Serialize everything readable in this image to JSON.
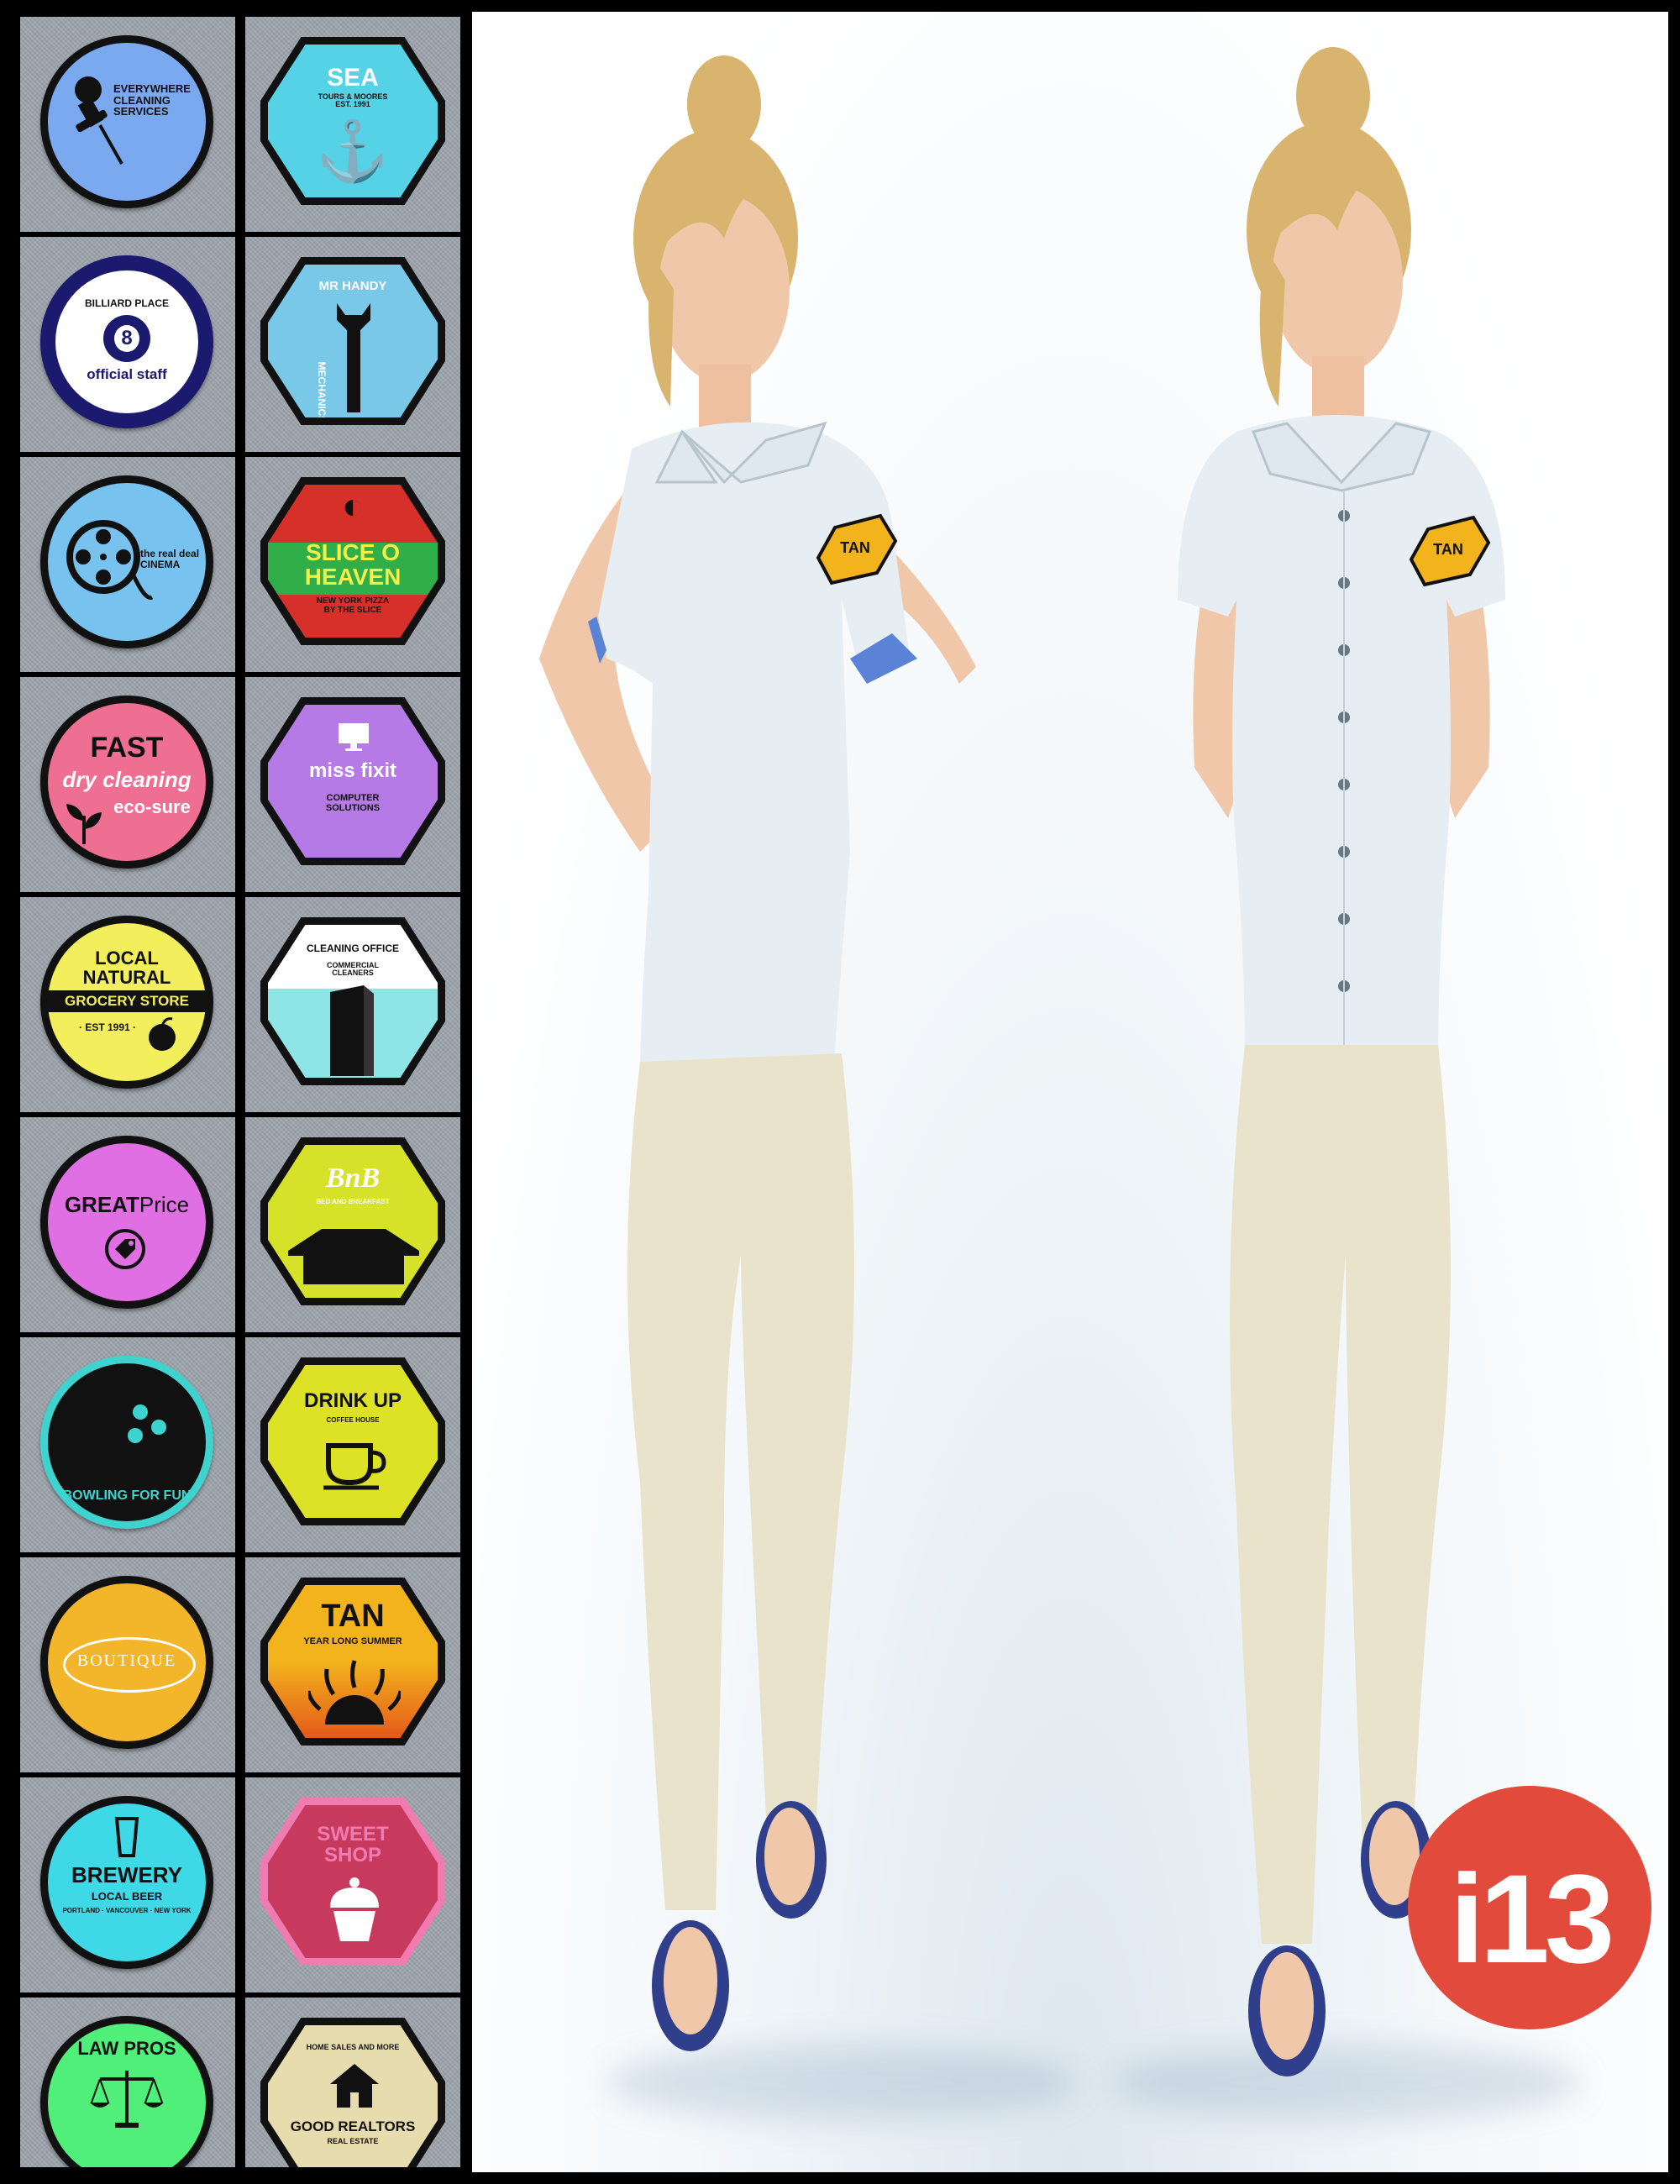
{
  "colors": {
    "fabric": "#9fa6af",
    "shirt": "#e6eef4",
    "pants": "#e9e3cc",
    "skin": "#f1c7a9",
    "hair": "#d9b46e",
    "logo_bg": "#e24a3b"
  },
  "badges": {
    "cleaning": {
      "text": "EVERYWHERE\nCLEANING\nSERVICES",
      "icon": "pushpin-icon",
      "color": "#7aa9f0"
    },
    "sea": {
      "title": "SEA",
      "sub": "TOURS & MOORES\nEST. 1991",
      "icon": "anchor-icon",
      "color": "#56d2e6"
    },
    "billiard": {
      "title": "BILLIARD PLACE",
      "number": "8",
      "sub": "official staff",
      "icon": "eight-ball-icon",
      "color": "#ffffff"
    },
    "mrhandy": {
      "title": "MR HANDY",
      "sub": "MECHANICS",
      "icon": "wrench-icon",
      "color": "#7ac8e8"
    },
    "cinema": {
      "text": "the real deal\nCINEMA",
      "icon": "film-reel-icon",
      "color": "#78c2ef"
    },
    "pizza": {
      "title": "SLICE O\nHEAVEN",
      "sub": "NEW YORK PIZZA\nBY THE SLICE",
      "icon": "pizza-icon",
      "color": "#d7302b",
      "accent": "#2fae4a"
    },
    "dryclean": {
      "title": "FAST",
      "script": "dry cleaning",
      "sub": "eco-sure",
      "icon": "leaf-icon",
      "color": "#ef6f93"
    },
    "missfixit": {
      "title": "miss fixit",
      "sub": "COMPUTER\nSOLUTIONS",
      "icon": "monitor-icon",
      "color": "#b57ae6"
    },
    "grocery": {
      "title": "LOCAL\nNATURAL",
      "band": "GROCERY STORE",
      "sub": "· EST 1991 ·",
      "icon": "apple-icon",
      "color": "#f2ee5c"
    },
    "cleaningoffice": {
      "title": "CLEANING OFFICE",
      "sub": "COMMERCIAL\nCLEANERS",
      "icon": "building-icon",
      "color": "#8fe4e6"
    },
    "greatprice": {
      "bold": "GREAT",
      "light": "Price",
      "icon": "price-tag-icon",
      "color": "#df6fe3"
    },
    "bnb": {
      "title": "BnB",
      "sub": "BED AND BREAKFAST",
      "icon": "house-icon",
      "color": "#d6e22a"
    },
    "bowling": {
      "text": "BOWLING FOR FUN",
      "icon": "bowling-ball-icon",
      "color": "#111111",
      "accent": "#3fd3cf"
    },
    "drinkup": {
      "title": "DRINK UP",
      "sub": "COFFEE HOUSE",
      "icon": "coffee-cup-icon",
      "color": "#dde227"
    },
    "boutique": {
      "title": "BOUTIQUE",
      "icon": "none",
      "color": "#f3b52a"
    },
    "tan": {
      "title": "TAN",
      "sub": "YEAR LONG SUMMER",
      "icon": "sun-icon",
      "color": "#f2b31d",
      "accent": "#e55a1a"
    },
    "brewery": {
      "title": "BREWERY",
      "sub": "LOCAL BEER",
      "small": "PORTLAND · VANCOUVER · NEW YORK",
      "icon": "beer-glass-icon",
      "color": "#3ed8e6"
    },
    "sweetshop": {
      "title": "SWEET\nSHOP",
      "icon": "cupcake-icon",
      "color": "#c73a5d",
      "accent": "#ef7bb0"
    },
    "lawpros": {
      "title": "LAW PROS",
      "icon": "scales-icon",
      "color": "#4fef7a"
    },
    "realtors": {
      "title": "GOOD REALTORS",
      "top": "HOME SALES AND MORE",
      "sub": "REAL ESTATE",
      "icon": "house-icon",
      "color": "#e7dcae"
    }
  },
  "models": {
    "left": {
      "chest_badge": "TAN",
      "style": "polo"
    },
    "right": {
      "chest_badge": "TAN",
      "style": "button-up"
    }
  },
  "logo": {
    "text": "i13"
  }
}
